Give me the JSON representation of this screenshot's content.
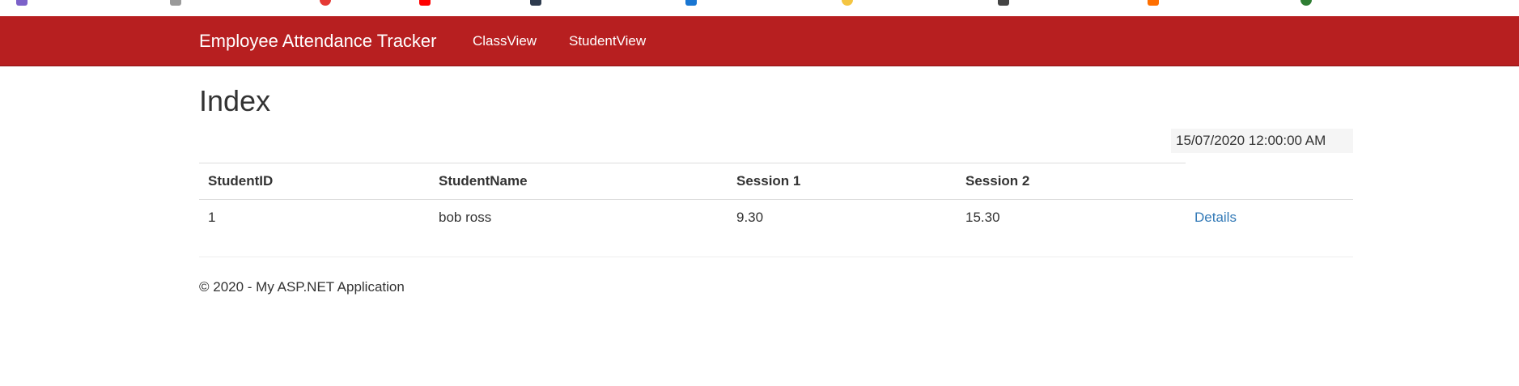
{
  "colors": {
    "navbar": "#b71f20",
    "link": "#337ab7",
    "text": "#333333"
  },
  "navbar": {
    "brand": "Employee Attendance Tracker",
    "links": [
      {
        "label": "ClassView"
      },
      {
        "label": "StudentView"
      }
    ]
  },
  "page": {
    "title": "Index",
    "date": "15/07/2020 12:00:00 AM"
  },
  "table": {
    "columns": [
      "StudentID",
      "StudentName",
      "Session 1",
      "Session 2"
    ],
    "rows": [
      {
        "id": "1",
        "name": "bob ross",
        "session1": "9.30",
        "session2": "15.30",
        "action": "Details"
      }
    ]
  },
  "footer": {
    "text": "© 2020 - My ASP.NET Application"
  }
}
